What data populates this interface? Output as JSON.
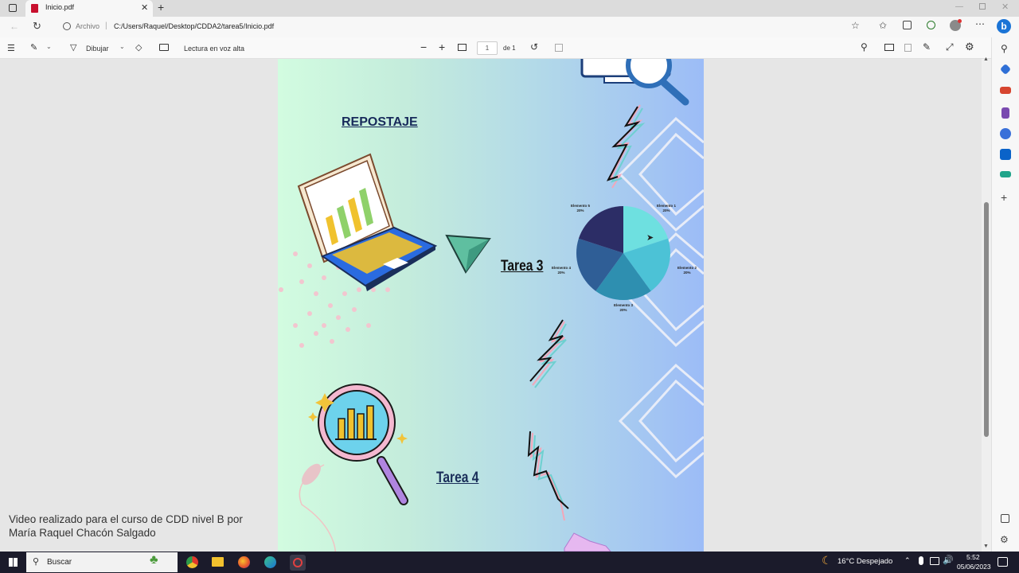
{
  "browser": {
    "tab_title": "Inicio.pdf",
    "address_scheme": "Archivo",
    "address_path": "C:/Users/Raquel/Desktop/CDDA2/tarea5/Inicio.pdf"
  },
  "pdf_toolbar": {
    "draw_label": "Dibujar",
    "read_aloud_label": "Lectura en voz alta",
    "page_number": "1",
    "page_total": "de 1"
  },
  "document": {
    "title": "REPOSTAJE",
    "task3_label": "Tarea 3",
    "task4_label": "Tarea 4",
    "pie_chart": {
      "slice_labels": [
        {
          "name": "Elemento 1",
          "pct": "20%"
        },
        {
          "name": "Elemento 2",
          "pct": "20%"
        },
        {
          "name": "Elemento 3",
          "pct": "20%"
        },
        {
          "name": "Elemento 4",
          "pct": "20%"
        },
        {
          "name": "Elemento 5",
          "pct": "20%"
        }
      ],
      "values": [
        20,
        20,
        20,
        20,
        20
      ],
      "colors": [
        "#6ee0e0",
        "#4cc2d6",
        "#2e8fb0",
        "#2f5e96",
        "#2c2d66"
      ]
    }
  },
  "caption": {
    "line1": "Video realizado para el curso de CDD nivel B por",
    "line2": "María Raquel Chacón Salgado"
  },
  "taskbar": {
    "search_placeholder": "Buscar",
    "weather": "16°C  Despejado",
    "time": "5:52",
    "date": "05/06/2023"
  }
}
